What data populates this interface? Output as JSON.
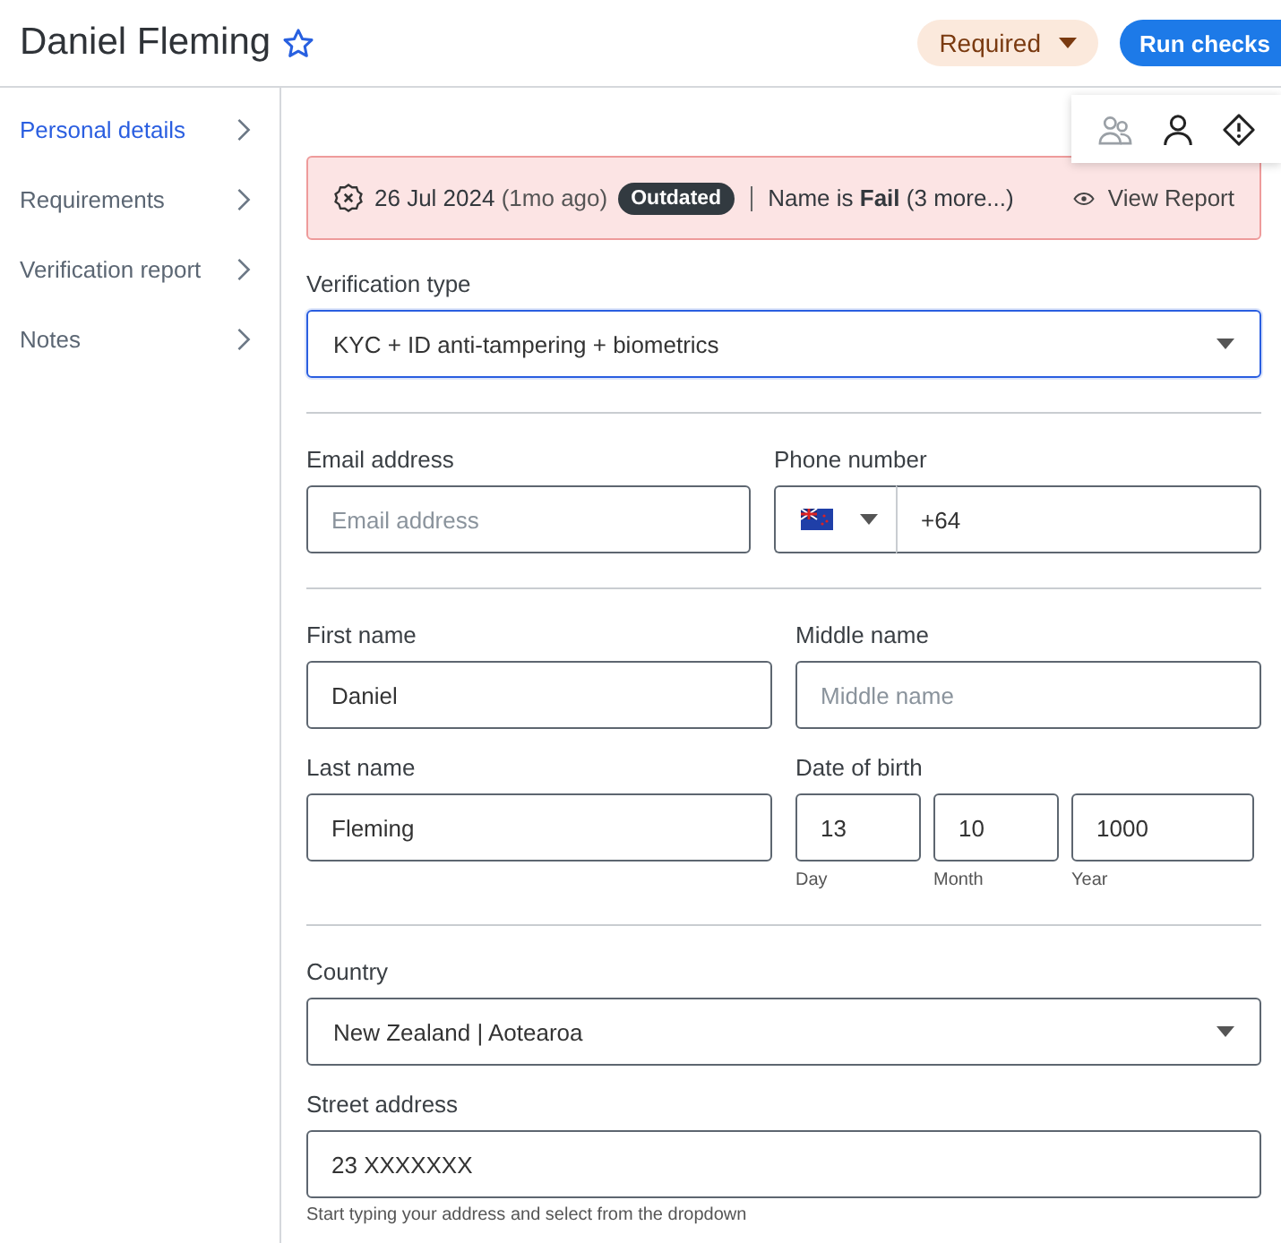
{
  "header": {
    "title": "Daniel Fleming",
    "status_dropdown": "Required",
    "run_button": "Run checks"
  },
  "sidebar": {
    "items": [
      {
        "label": "Personal details",
        "selected": true
      },
      {
        "label": "Requirements",
        "selected": false
      },
      {
        "label": "Verification report",
        "selected": false
      },
      {
        "label": "Notes",
        "selected": false
      }
    ]
  },
  "alert": {
    "date": "26 Jul 2024",
    "relative": "(1mo ago)",
    "badge": "Outdated",
    "summary": "Name is **Fail** (3 more...)",
    "link": "View Report"
  },
  "sections": [
    {
      "rows": [
        [
          {
            "kind": "select",
            "label": "Verification type",
            "value": "KYC + ID anti-tampering + biometrics",
            "focused": true
          }
        ]
      ]
    },
    {
      "rows": [
        [
          {
            "kind": "text",
            "label": "Email address",
            "placeholder": "Email address"
          },
          {
            "kind": "phone",
            "label": "Phone number",
            "value": "+64"
          }
        ]
      ]
    },
    {
      "rows": [
        [
          {
            "kind": "text",
            "label": "First name",
            "value": "Daniel"
          },
          {
            "kind": "text",
            "label": "Middle name",
            "placeholder": "Middle name"
          }
        ],
        [
          {
            "kind": "text",
            "label": "Last name",
            "value": "Fleming"
          },
          {
            "kind": "date",
            "label": "Date of birth",
            "parts": [
              {
                "value": "13",
                "caption": "Day"
              },
              {
                "value": "10",
                "caption": "Month"
              },
              {
                "value": "1000",
                "caption": "Year"
              }
            ]
          }
        ]
      ]
    },
    {
      "rows": [
        [
          {
            "kind": "select",
            "label": "Country",
            "value": "New Zealand | Aotearoa",
            "focused": false
          }
        ],
        [
          {
            "kind": "text",
            "label": "Street address",
            "value": "23 XXXXXXX",
            "hint": "Start typing your address and select from the dropdown"
          }
        ]
      ]
    }
  ]
}
